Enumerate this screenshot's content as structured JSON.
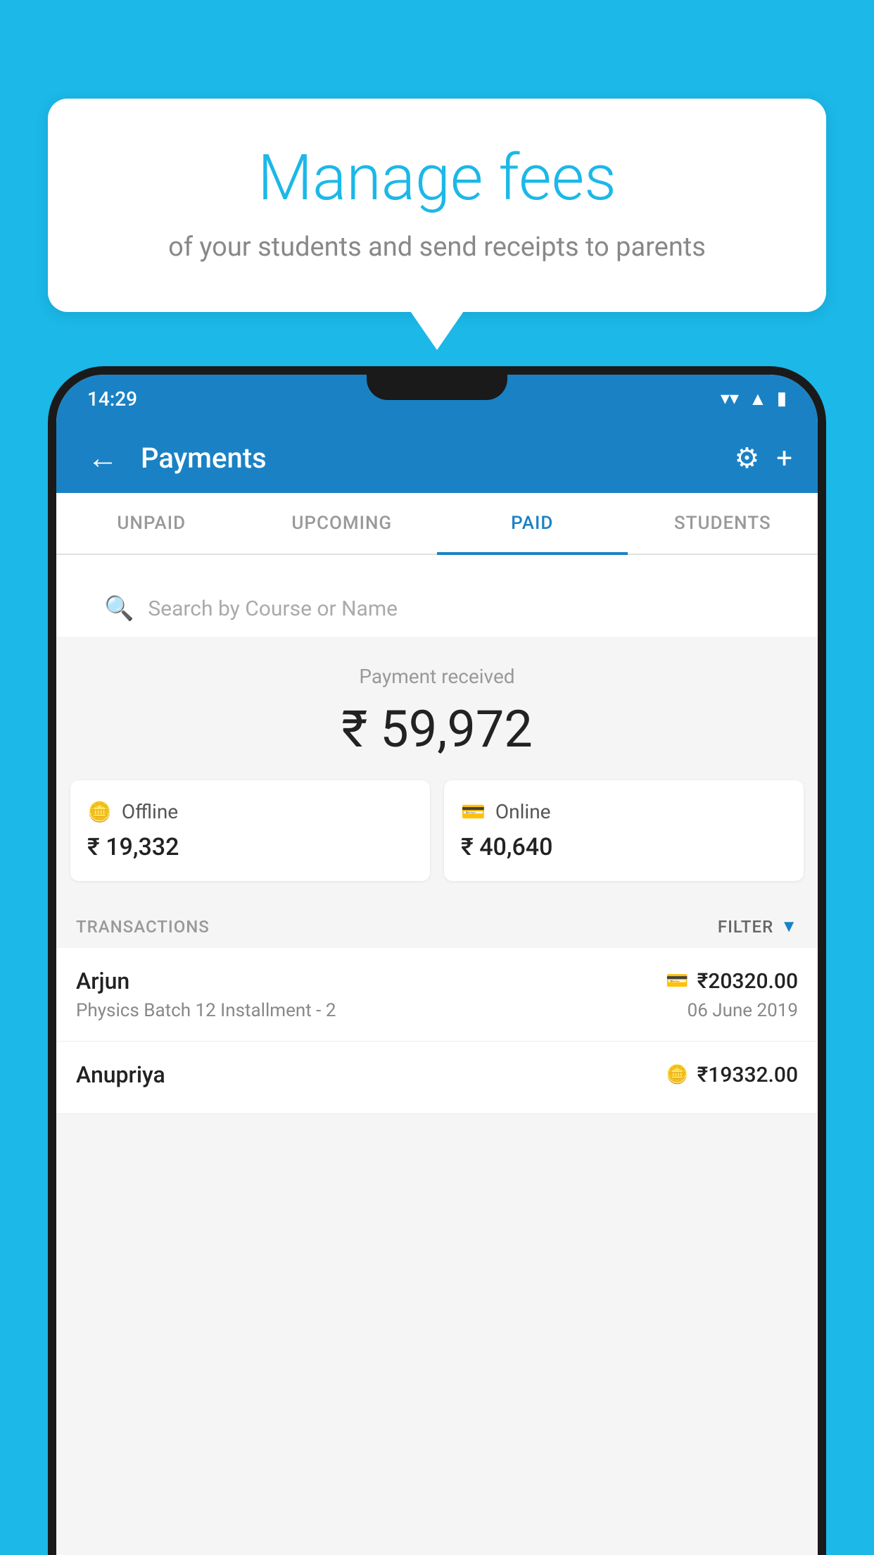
{
  "background_color": "#1bb8e8",
  "bubble": {
    "title": "Manage fees",
    "subtitle": "of your students and send receipts to parents"
  },
  "status_bar": {
    "time": "14:29"
  },
  "app_bar": {
    "title": "Payments",
    "back_icon": "←",
    "gear_icon": "⚙",
    "plus_icon": "+"
  },
  "tabs": [
    {
      "label": "UNPAID",
      "active": false
    },
    {
      "label": "UPCOMING",
      "active": false
    },
    {
      "label": "PAID",
      "active": true
    },
    {
      "label": "STUDENTS",
      "active": false
    }
  ],
  "search": {
    "placeholder": "Search by Course or Name"
  },
  "payment_summary": {
    "label": "Payment received",
    "amount": "₹ 59,972",
    "offline": {
      "label": "Offline",
      "amount": "₹ 19,332"
    },
    "online": {
      "label": "Online",
      "amount": "₹ 40,640"
    }
  },
  "transactions": {
    "label": "TRANSACTIONS",
    "filter_label": "FILTER",
    "items": [
      {
        "name": "Arjun",
        "course": "Physics Batch 12 Installment - 2",
        "amount": "₹20320.00",
        "date": "06 June 2019",
        "payment_type": "card"
      },
      {
        "name": "Anupriya",
        "course": "",
        "amount": "₹19332.00",
        "date": "",
        "payment_type": "offline"
      }
    ]
  }
}
